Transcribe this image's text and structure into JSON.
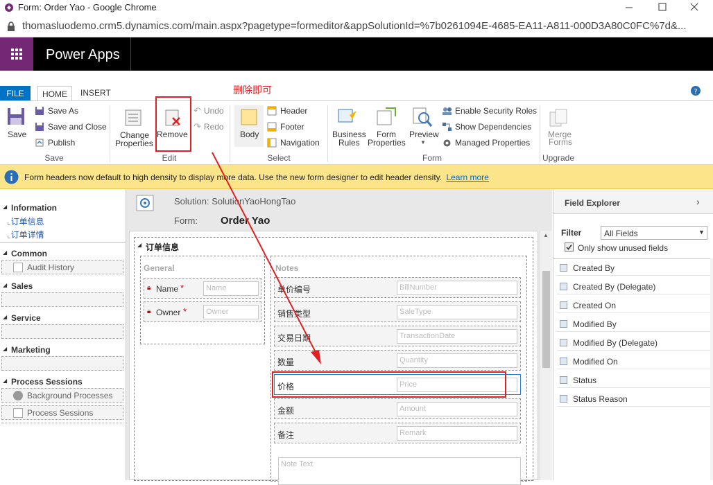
{
  "window": {
    "title": "Form: Order Yao - Google Chrome"
  },
  "address": {
    "url": "thomasluodemo.crm5.dynamics.com/main.aspx?pagetype=formeditor&appSolutionId=%7b0261094E-4685-EA11-A811-000D3A80C0FC%7d&..."
  },
  "app": {
    "name": "Power Apps"
  },
  "ribbon": {
    "tabs": [
      "FILE",
      "HOME",
      "INSERT"
    ],
    "annotation": "删除即可",
    "save": {
      "save": "Save",
      "save_as": "Save As",
      "save_close": "Save and Close",
      "publish": "Publish",
      "group": "Save"
    },
    "edit": {
      "change_properties_1": "Change",
      "change_properties_2": "Properties",
      "remove": "Remove",
      "undo": "Undo",
      "redo": "Redo",
      "group": "Edit"
    },
    "select": {
      "body": "Body",
      "header": "Header",
      "footer": "Footer",
      "navigation": "Navigation",
      "group": "Select"
    },
    "form": {
      "business_rules_1": "Business",
      "business_rules_2": "Rules",
      "form_properties_1": "Form",
      "form_properties_2": "Properties",
      "preview": "Preview",
      "enable_security": "Enable Security Roles",
      "show_dependencies": "Show Dependencies",
      "managed_properties": "Managed Properties",
      "group": "Form"
    },
    "upgrade": {
      "merge_forms_1": "Merge",
      "merge_forms_2": "Forms",
      "group": "Upgrade"
    }
  },
  "notice": {
    "text": "Form headers now default to high density to display more data. Use the new form designer to edit header density.",
    "link": "Learn more"
  },
  "leftnav": {
    "information": "Information",
    "info_items": [
      "订单信息",
      "订单详情"
    ],
    "common": "Common",
    "audit_history": "Audit History",
    "sales": "Sales",
    "service": "Service",
    "marketing": "Marketing",
    "process_sessions": "Process Sessions",
    "background_processes": "Background Processes",
    "process_sessions_item": "Process Sessions"
  },
  "form": {
    "solution_label": "Solution: SolutionYaoHongTao",
    "form_label": "Form:",
    "form_name": "Order Yao",
    "tab_name": "订单信息",
    "general": "General",
    "notes": "Notes",
    "name_label": "Name",
    "name_placeholder": "Name",
    "owner_label": "Owner",
    "owner_placeholder": "Owner",
    "required_mark": "*",
    "fields": [
      {
        "label": "单价编号",
        "placeholder": "BillNumber"
      },
      {
        "label": "销售类型",
        "placeholder": "SaleType"
      },
      {
        "label": "交易日期",
        "placeholder": "TransactionDate"
      },
      {
        "label": "数量",
        "placeholder": "Quantity"
      },
      {
        "label": "价格",
        "placeholder": "Price"
      },
      {
        "label": "金额",
        "placeholder": "Amount"
      },
      {
        "label": "备注",
        "placeholder": "Remark"
      }
    ],
    "note_text": "Note Text"
  },
  "explorer": {
    "title": "Field Explorer",
    "filter_label": "Filter",
    "filter_value": "All Fields",
    "unused_label": "Only show unused fields",
    "items": [
      "Created By",
      "Created By (Delegate)",
      "Created On",
      "Modified By",
      "Modified By (Delegate)",
      "Modified On",
      "Status",
      "Status Reason"
    ]
  },
  "colors": {
    "accent": "#742774",
    "annotation": "#e02020",
    "link": "#0066cc",
    "ribbon_tab": "#0072c6"
  }
}
